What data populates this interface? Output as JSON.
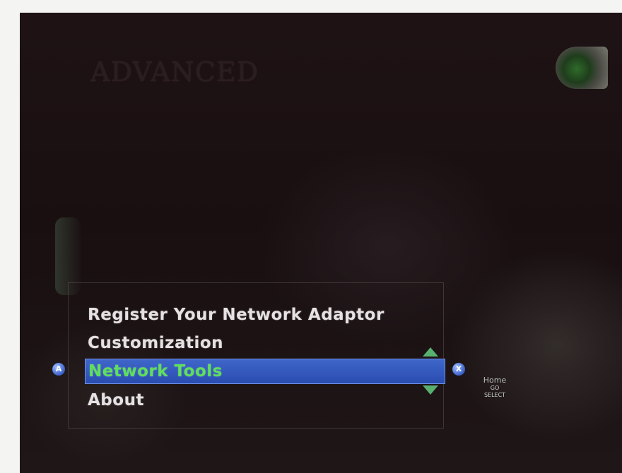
{
  "header": {
    "title": "ADVANCED"
  },
  "menu": {
    "items": [
      {
        "label": "Register Your Network Adaptor",
        "selected": false
      },
      {
        "label": "Customization",
        "selected": false
      },
      {
        "label": "Network Tools",
        "selected": true
      },
      {
        "label": "About",
        "selected": false
      }
    ]
  },
  "controls": {
    "left_button": "A",
    "right_button": "X",
    "hint_title": "Home",
    "hint_line1": "GO",
    "hint_line2": "SELECT"
  },
  "colors": {
    "background": "#1b1113",
    "selection": "#2f54b8",
    "selected_text": "#5fe05a",
    "menu_text": "#e6e2e4"
  }
}
